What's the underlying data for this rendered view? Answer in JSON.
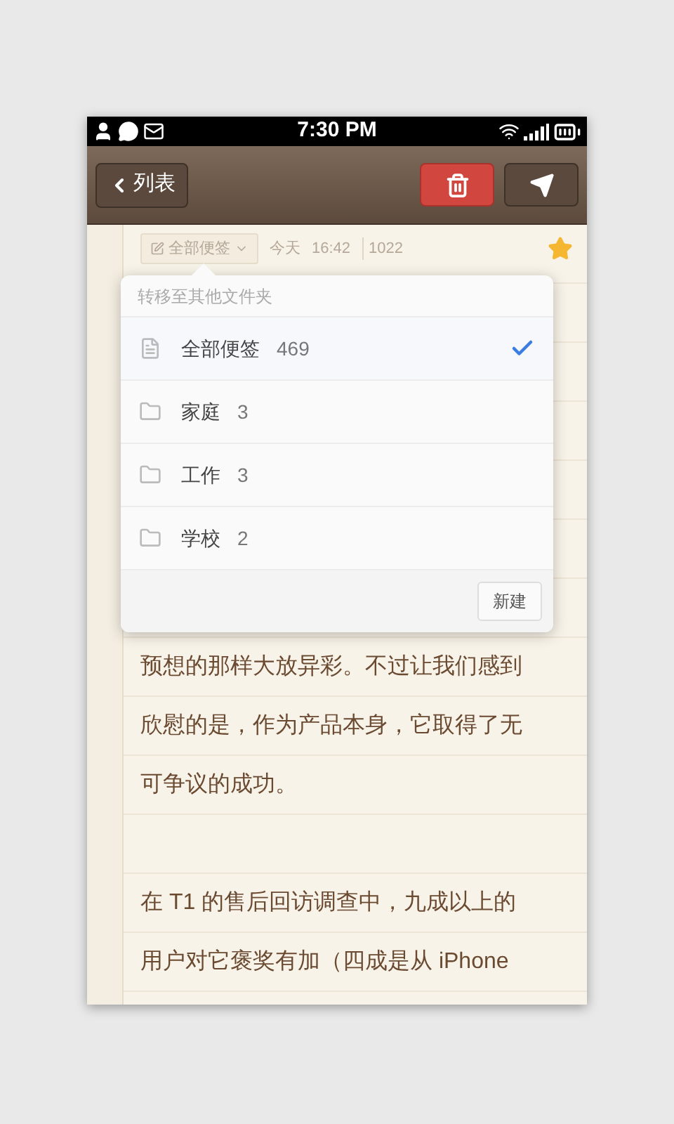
{
  "status_bar": {
    "time": "7:30 PM"
  },
  "nav": {
    "back": "列表"
  },
  "note_meta": {
    "folder": "全部便签",
    "date": "今天",
    "time": "16:42",
    "count": "1022",
    "starred": true
  },
  "popup": {
    "title": "转移至其他文件夹",
    "folders": [
      {
        "kind": "notes",
        "name": "全部便签",
        "count": "469",
        "selected": true
      },
      {
        "kind": "folder",
        "name": "家庭",
        "count": "3",
        "selected": false
      },
      {
        "kind": "folder",
        "name": "工作",
        "count": "3",
        "selected": false
      },
      {
        "kind": "folder",
        "name": "学校",
        "count": "2",
        "selected": false
      }
    ],
    "new_button": "新建"
  },
  "paragraphs": [
    {
      "lines": [
        "预想的那样大放异彩。不过让我们感到",
        "欣慰的是，作为产品本身，它取得了无",
        "可争议的成功。"
      ]
    },
    {
      "lines": [
        "在 T1 的售后回访调查中，九成以上的",
        "用户对它褒奖有加（四成是从 iPhone"
      ]
    }
  ]
}
